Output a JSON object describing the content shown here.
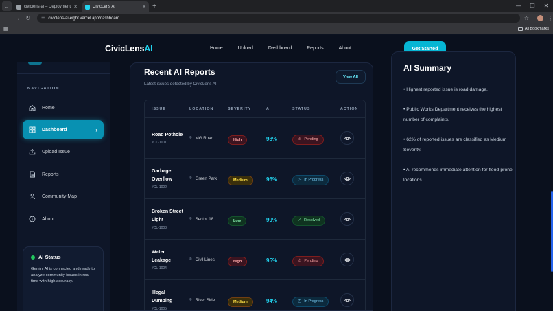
{
  "browser": {
    "tabs": [
      {
        "label": "civiclens-ai – Deployment Overv",
        "active": false
      },
      {
        "label": "CivicLens AI",
        "active": true
      }
    ],
    "url": "civiclens-ai-eight.vercel.app/dashboard",
    "bookmarks_label": "All Bookmarks"
  },
  "header": {
    "logo_main": "CivicLens",
    "logo_ai": "AI",
    "nav": [
      "Home",
      "Upload",
      "Dashboard",
      "Reports",
      "About"
    ],
    "cta": "Get Started"
  },
  "sidebar": {
    "caption": "NAVIGATION",
    "items": [
      {
        "label": "Home",
        "icon": "home-icon"
      },
      {
        "label": "Dashboard",
        "icon": "grid-icon",
        "active": true
      },
      {
        "label": "Upload Issue",
        "icon": "upload-icon"
      },
      {
        "label": "Reports",
        "icon": "document-icon"
      },
      {
        "label": "Community Map",
        "icon": "people-icon"
      },
      {
        "label": "About",
        "icon": "info-icon"
      }
    ],
    "status": {
      "title": "AI Status",
      "description": "Gemini AI is connected and ready to analyze community issues in real time with high accuracy."
    }
  },
  "reports": {
    "title": "Recent AI Reports",
    "subtitle": "Latest issues detected by CivicLens AI",
    "view_all": "View All",
    "columns": [
      "ISSUE",
      "LOCATION",
      "SEVERITY",
      "AI",
      "STATUS",
      "ACTION"
    ],
    "rows": [
      {
        "issue": "Road Pothole",
        "id": "#CL-1001",
        "location": "MG Road",
        "severity": "High",
        "ai": "98%",
        "status": "Pending",
        "status_class": "Pending"
      },
      {
        "issue": "Garbage Overflow",
        "id": "#CL-1002",
        "location": "Green Park",
        "severity": "Medium",
        "ai": "96%",
        "status": "In Progress",
        "status_class": "Progress"
      },
      {
        "issue": "Broken Street Light",
        "id": "#CL-1003",
        "location": "Sector 18",
        "severity": "Low",
        "ai": "99%",
        "status": "Resolved",
        "status_class": "Resolved"
      },
      {
        "issue": "Water Leakage",
        "id": "#CL-1004",
        "location": "Civil Lines",
        "severity": "High",
        "ai": "95%",
        "status": "Pending",
        "status_class": "Pending"
      },
      {
        "issue": "Illegal Dumping",
        "id": "#CL-1005",
        "location": "River Side",
        "severity": "Medium",
        "ai": "94%",
        "status": "In Progress",
        "status_class": "Progress"
      }
    ]
  },
  "summary": {
    "title": "AI Summary",
    "items": [
      "• Highest reported issue is road damage.",
      "• Public Works Department receives the highest number of complaints.",
      "• 62% of reported issues are classified as Medium Severity.",
      "• AI recommends immediate attention for flood-prone locations."
    ]
  },
  "colors": {
    "accent": "#22d3ee",
    "active_nav": "#0891b2",
    "background": "#0a101d"
  }
}
